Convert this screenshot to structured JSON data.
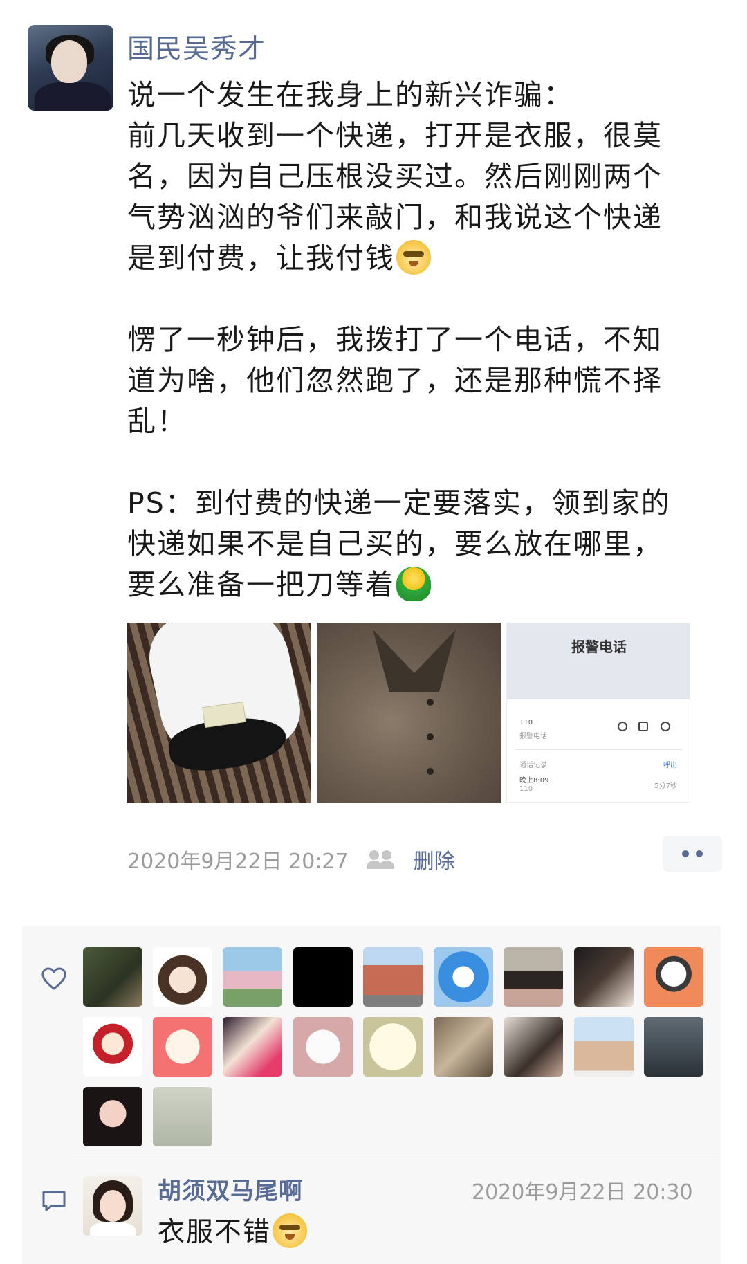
{
  "post": {
    "author": "国民吴秀才",
    "paragraphs": [
      {
        "lines": [
          "说一个发生在我身上的新兴诈骗：",
          "前几天收到一个快递，打开是衣服，很莫",
          "名，因为自己压根没买过。然后刚刚两个",
          "气势汹汹的爷们来敲门，和我说这个快递",
          "是到付费，让我付钱"
        ],
        "trailing_emoji": "doge-emoji"
      },
      {
        "lines": [
          "愣了一秒钟后，我拨打了一个电话，不知",
          "道为啥，他们忽然跑了，还是那种慌不择",
          "乱！"
        ],
        "trailing_emoji": null
      },
      {
        "lines": [
          "PS：到付费的快递一定要落实，领到家的",
          "快递如果不是自己买的，要么放在哪里，",
          "要么准备一把刀等着"
        ],
        "trailing_emoji": "green-shirt-emoji"
      }
    ],
    "photos": [
      {
        "name": "torn-package-photo"
      },
      {
        "name": "tweed-coat-photo"
      },
      {
        "name": "police-call-screenshot",
        "title": "报警电话",
        "number": "110",
        "number_sub": "报警电话",
        "records_label": "通话记录",
        "records_tag": "呼出",
        "record_time": "晚上8:09",
        "record_number": "110",
        "record_duration": "5分7秒"
      }
    ],
    "timestamp": "2020年9月22日 20:27",
    "delete_label": "删除",
    "more_icon": "more-dots-icon",
    "visibility_icon": "group-visibility-icon"
  },
  "likes": {
    "icon": "heart-outline-icon",
    "count": 20
  },
  "comment": {
    "icon": "comment-bubble-icon",
    "author": "胡须双马尾啊",
    "time": "2020年9月22日 20:30",
    "text": "衣服不错",
    "trailing_emoji": "doge-emoji"
  },
  "colors": {
    "link": "#576b95",
    "meta_gray": "#9b9b9b",
    "interaction_bg": "#f7f7f7"
  }
}
